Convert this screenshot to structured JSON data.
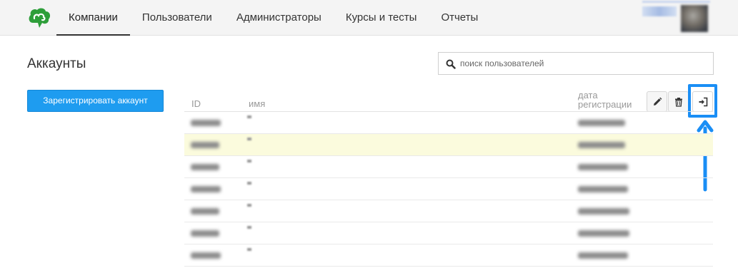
{
  "nav": {
    "items": [
      {
        "label": "Компании",
        "active": true
      },
      {
        "label": "Пользователи",
        "active": false
      },
      {
        "label": "Администраторы",
        "active": false
      },
      {
        "label": "Курсы и тесты",
        "active": false
      },
      {
        "label": "Отчеты",
        "active": false
      }
    ]
  },
  "page": {
    "title": "Аккаунты",
    "register_button": "Зарегистрировать аккаунт"
  },
  "search": {
    "placeholder": "поиск пользователей",
    "value": ""
  },
  "table": {
    "columns": {
      "id": "ID",
      "name": "имя",
      "date": "дата регистрации"
    },
    "row_count": 7,
    "highlighted_row": 2
  },
  "colors": {
    "accent": "#1e9cf0",
    "highlight_row": "#fbfbdd",
    "annotation": "#1a8ef5",
    "logo_green": "#2e9e3a"
  },
  "icons": [
    "logo-icon",
    "search-icon",
    "pencil-icon",
    "trash-icon",
    "sign-in-icon",
    "arrow-up-icon"
  ]
}
